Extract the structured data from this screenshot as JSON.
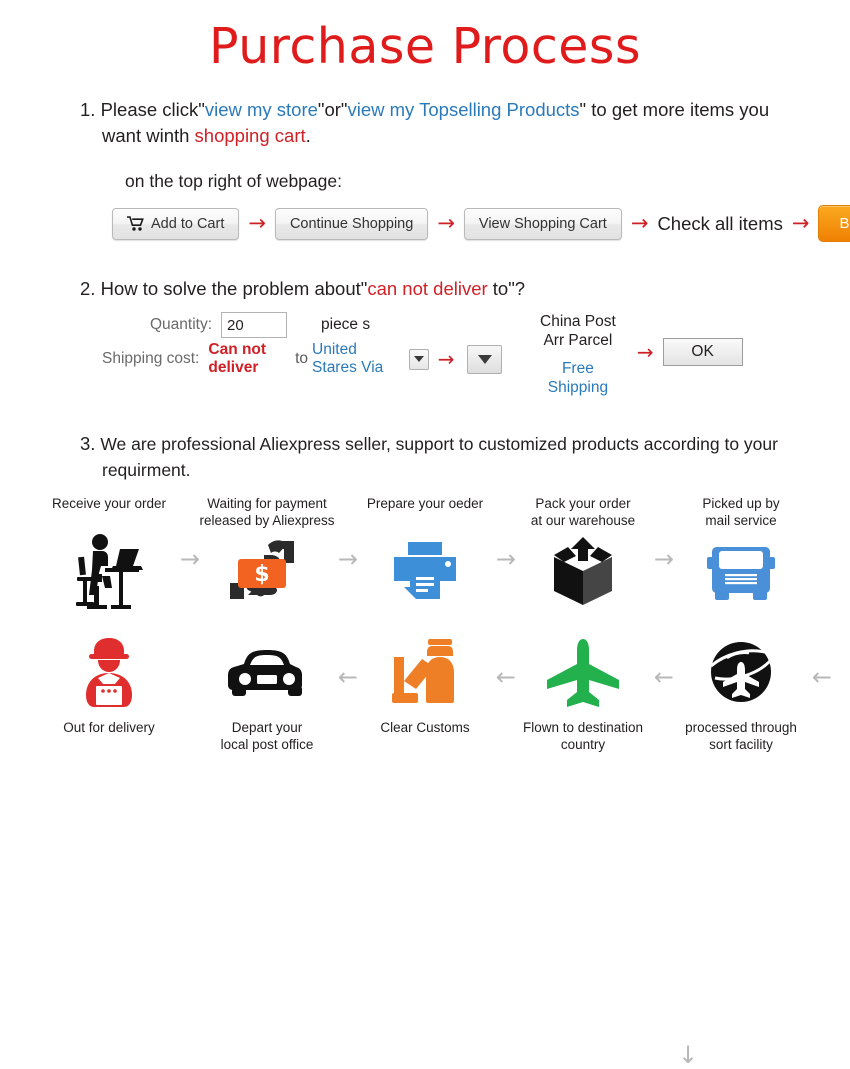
{
  "title": "Purchase Process",
  "accent_red": "#d12026",
  "accent_blue": "#2a7ab9",
  "step1": {
    "number": "1.",
    "t1": "Please click\"",
    "link1": "view my store",
    "t2": "\"or\"",
    "link2": "view my Topselling Products",
    "t3": "\" to get more items you want",
    "l2a": "winth ",
    "l2red": "shopping cart",
    "l2b": ".",
    "subnote": "on the top right of webpage:",
    "buttons": {
      "add_to_cart": "Add to Cart",
      "continue_shopping": "Continue Shopping",
      "view_shopping_cart": "View Shopping Cart",
      "check_all_items": "Check all items",
      "buy_now": "Buy Now"
    },
    "cart_icon": "shopping-cart-icon",
    "arrow": "→"
  },
  "step2": {
    "number": "2.",
    "t1": "How to solve the problem about\"",
    "red": "can not deliver",
    "t2": " to\"?",
    "quantity_label": "Quantity:",
    "quantity_value": "20",
    "piece_label": "piece s",
    "shipping_label": "Shipping cost:",
    "shipping_red": "Can not deliver",
    "shipping_to": "to",
    "shipping_dest": "United Stares Via",
    "carrier_line1": "China Post",
    "carrier_line2": "Arr Parcel",
    "free_line1": "Free",
    "free_line2": "Shipping",
    "ok_label": "OK",
    "arrow": "→"
  },
  "step3": {
    "number": "3.",
    "text": "We are professional Aliexpress seller, support to customized products according to your requirment.",
    "row1": [
      {
        "caption": "Receive your order",
        "icon": "person-at-desk-icon"
      },
      {
        "caption": "Waiting for payment\nreleased by Aliexpress",
        "icon": "cash-in-hand-icon"
      },
      {
        "caption": "Prepare your oeder",
        "icon": "printer-icon"
      },
      {
        "caption": "Pack your order\nat our warehouse",
        "icon": "package-box-icon"
      },
      {
        "caption": "Picked up by\nmail service",
        "icon": "delivery-truck-icon"
      }
    ],
    "row2": [
      {
        "caption": "Out for delivery",
        "icon": "delivery-person-icon"
      },
      {
        "caption": "Depart your\nlocal post office",
        "icon": "car-icon"
      },
      {
        "caption": "Clear Customs",
        "icon": "customs-officer-icon"
      },
      {
        "caption": "Flown to destination\ncountry",
        "icon": "airplane-icon"
      },
      {
        "caption": "processed through\nsort facility",
        "icon": "globe-plane-icon"
      }
    ],
    "arrow_right": "→",
    "arrow_left": "←",
    "arrow_down": "↓"
  }
}
